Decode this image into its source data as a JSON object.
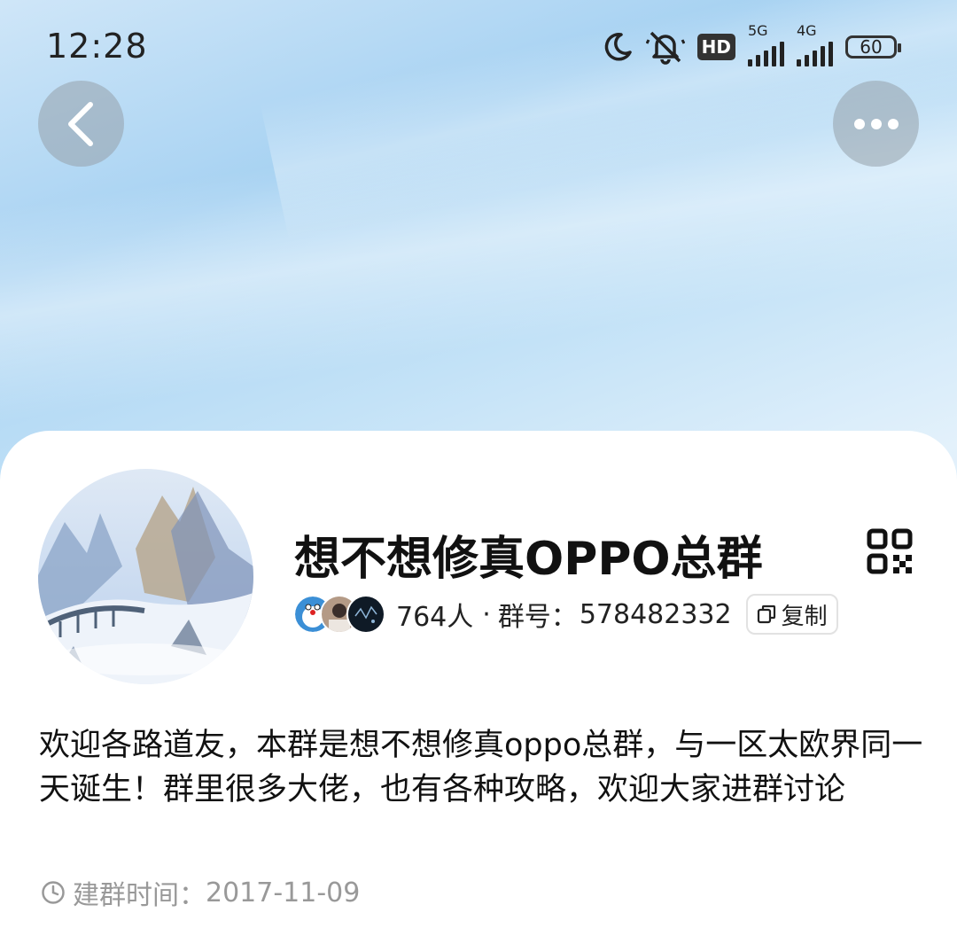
{
  "status_bar": {
    "time": "12:28",
    "hd_label": "HD",
    "net1_label": "5G",
    "net2_label": "4G",
    "battery": "60"
  },
  "group": {
    "name": "想不想修真OPPO总群",
    "member_count": "764人",
    "separator": "·",
    "group_no_label": "群号：",
    "group_no": "578482332",
    "copy_label": "复制",
    "description": "欢迎各路道友，本群是想不想修真oppo总群，与一区太欧界同一天诞生！群里很多大佬，也有各种攻略，欢迎大家进群讨论",
    "created_label": "建群时间：",
    "created_date": "2017-11-09"
  },
  "icons": {
    "back": "chevron-left-icon",
    "more": "more-horizontal-icon",
    "qr": "qr-code-icon",
    "copy": "copy-icon",
    "clock": "clock-icon",
    "moon": "moon-icon",
    "mute": "bell-muted-icon"
  },
  "colors": {
    "header_sky": "#a7d2f2",
    "button_overlay": "#969fa8",
    "secondary_text": "#999999"
  }
}
